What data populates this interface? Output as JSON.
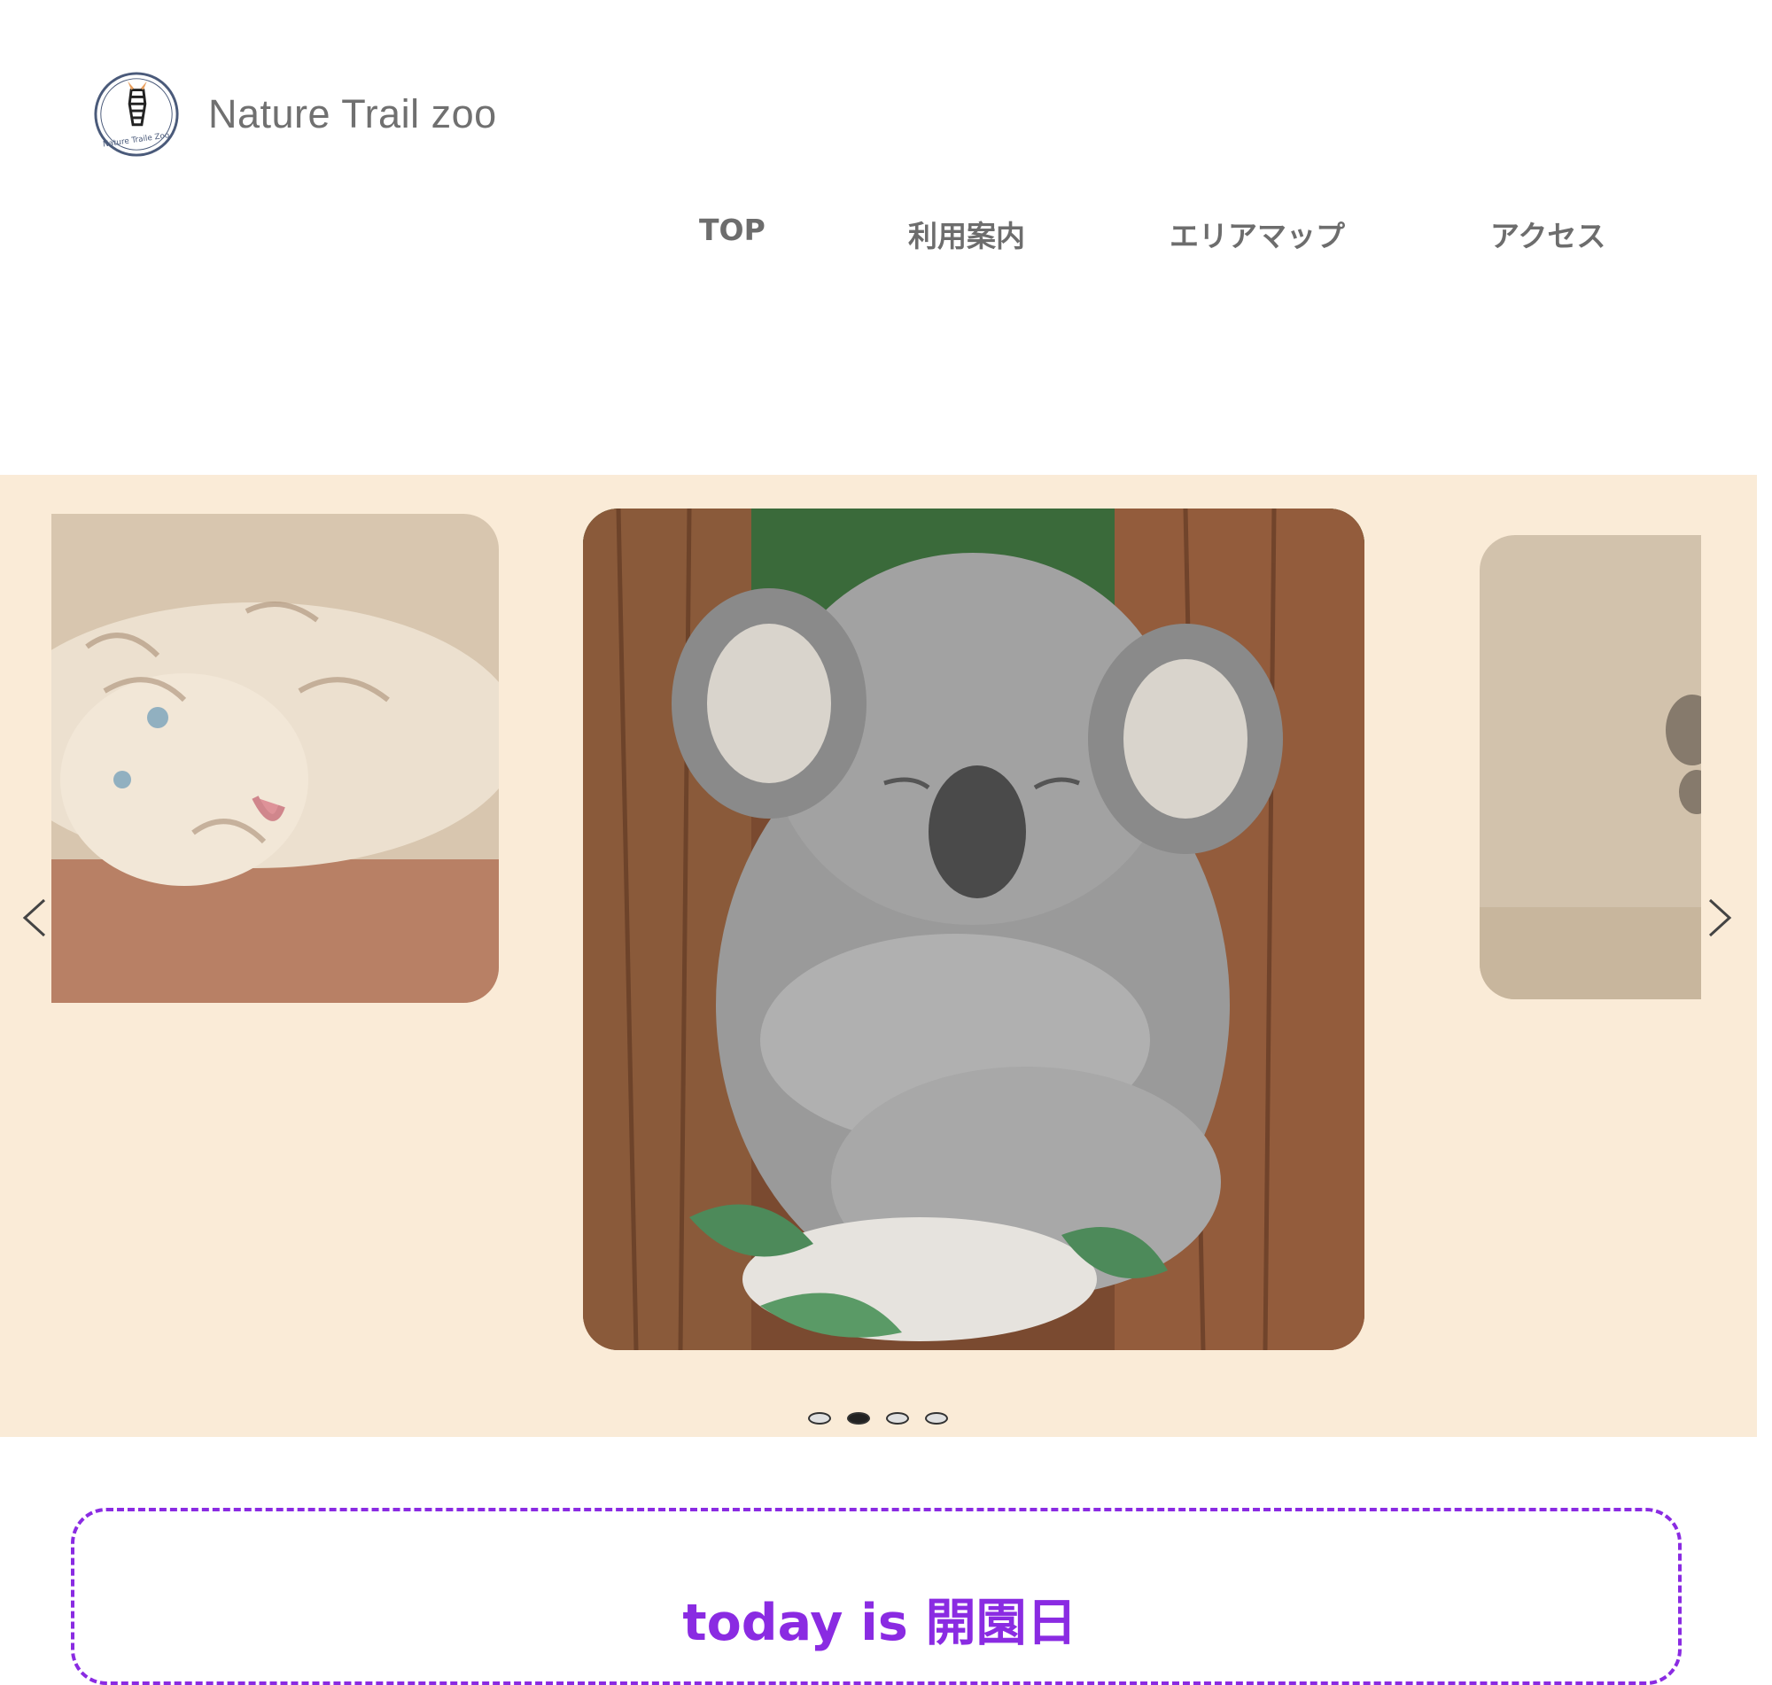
{
  "brand": {
    "name": "Nature Trail zoo",
    "badge_text": "Nature Traile Zoo"
  },
  "nav": {
    "items": [
      {
        "label": "TOP"
      },
      {
        "label": "利用案内"
      },
      {
        "label": "エリアマップ"
      },
      {
        "label": "アクセス"
      }
    ]
  },
  "carousel": {
    "slides": [
      {
        "icon": "tiger-photo",
        "state": "prev"
      },
      {
        "icon": "koala-photo",
        "state": "current"
      },
      {
        "icon": "animal-photo",
        "state": "next"
      }
    ],
    "dots": [
      {
        "active": false
      },
      {
        "active": true
      },
      {
        "active": false
      },
      {
        "active": false
      }
    ],
    "background_color": "#faebd7"
  },
  "today": {
    "prefix": "today is",
    "status": "開園日",
    "color": "#8a2be2"
  }
}
